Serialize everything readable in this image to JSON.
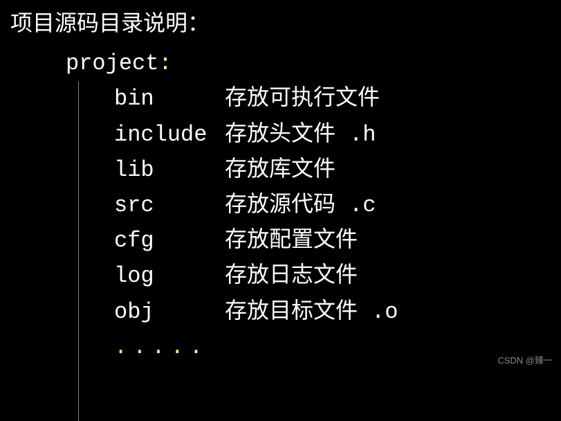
{
  "title": "项目源码目录说明：",
  "project_label": "project",
  "colon": ":",
  "directories": [
    {
      "name": "bin",
      "desc": "存放可执行文件",
      "ext": ""
    },
    {
      "name": "include",
      "desc": "存放头文件",
      "ext": ".h"
    },
    {
      "name": "lib",
      "desc": "存放库文件",
      "ext": ""
    },
    {
      "name": "src",
      "desc": "存放源代码",
      "ext": ".c"
    },
    {
      "name": "cfg",
      "desc": "存放配置文件",
      "ext": ""
    },
    {
      "name": "log",
      "desc": "存放日志文件",
      "ext": ""
    },
    {
      "name": "obj",
      "desc": "存放目标文件",
      "ext": ".o"
    }
  ],
  "ellipsis": ".....",
  "watermark": "CSDN @臻一"
}
